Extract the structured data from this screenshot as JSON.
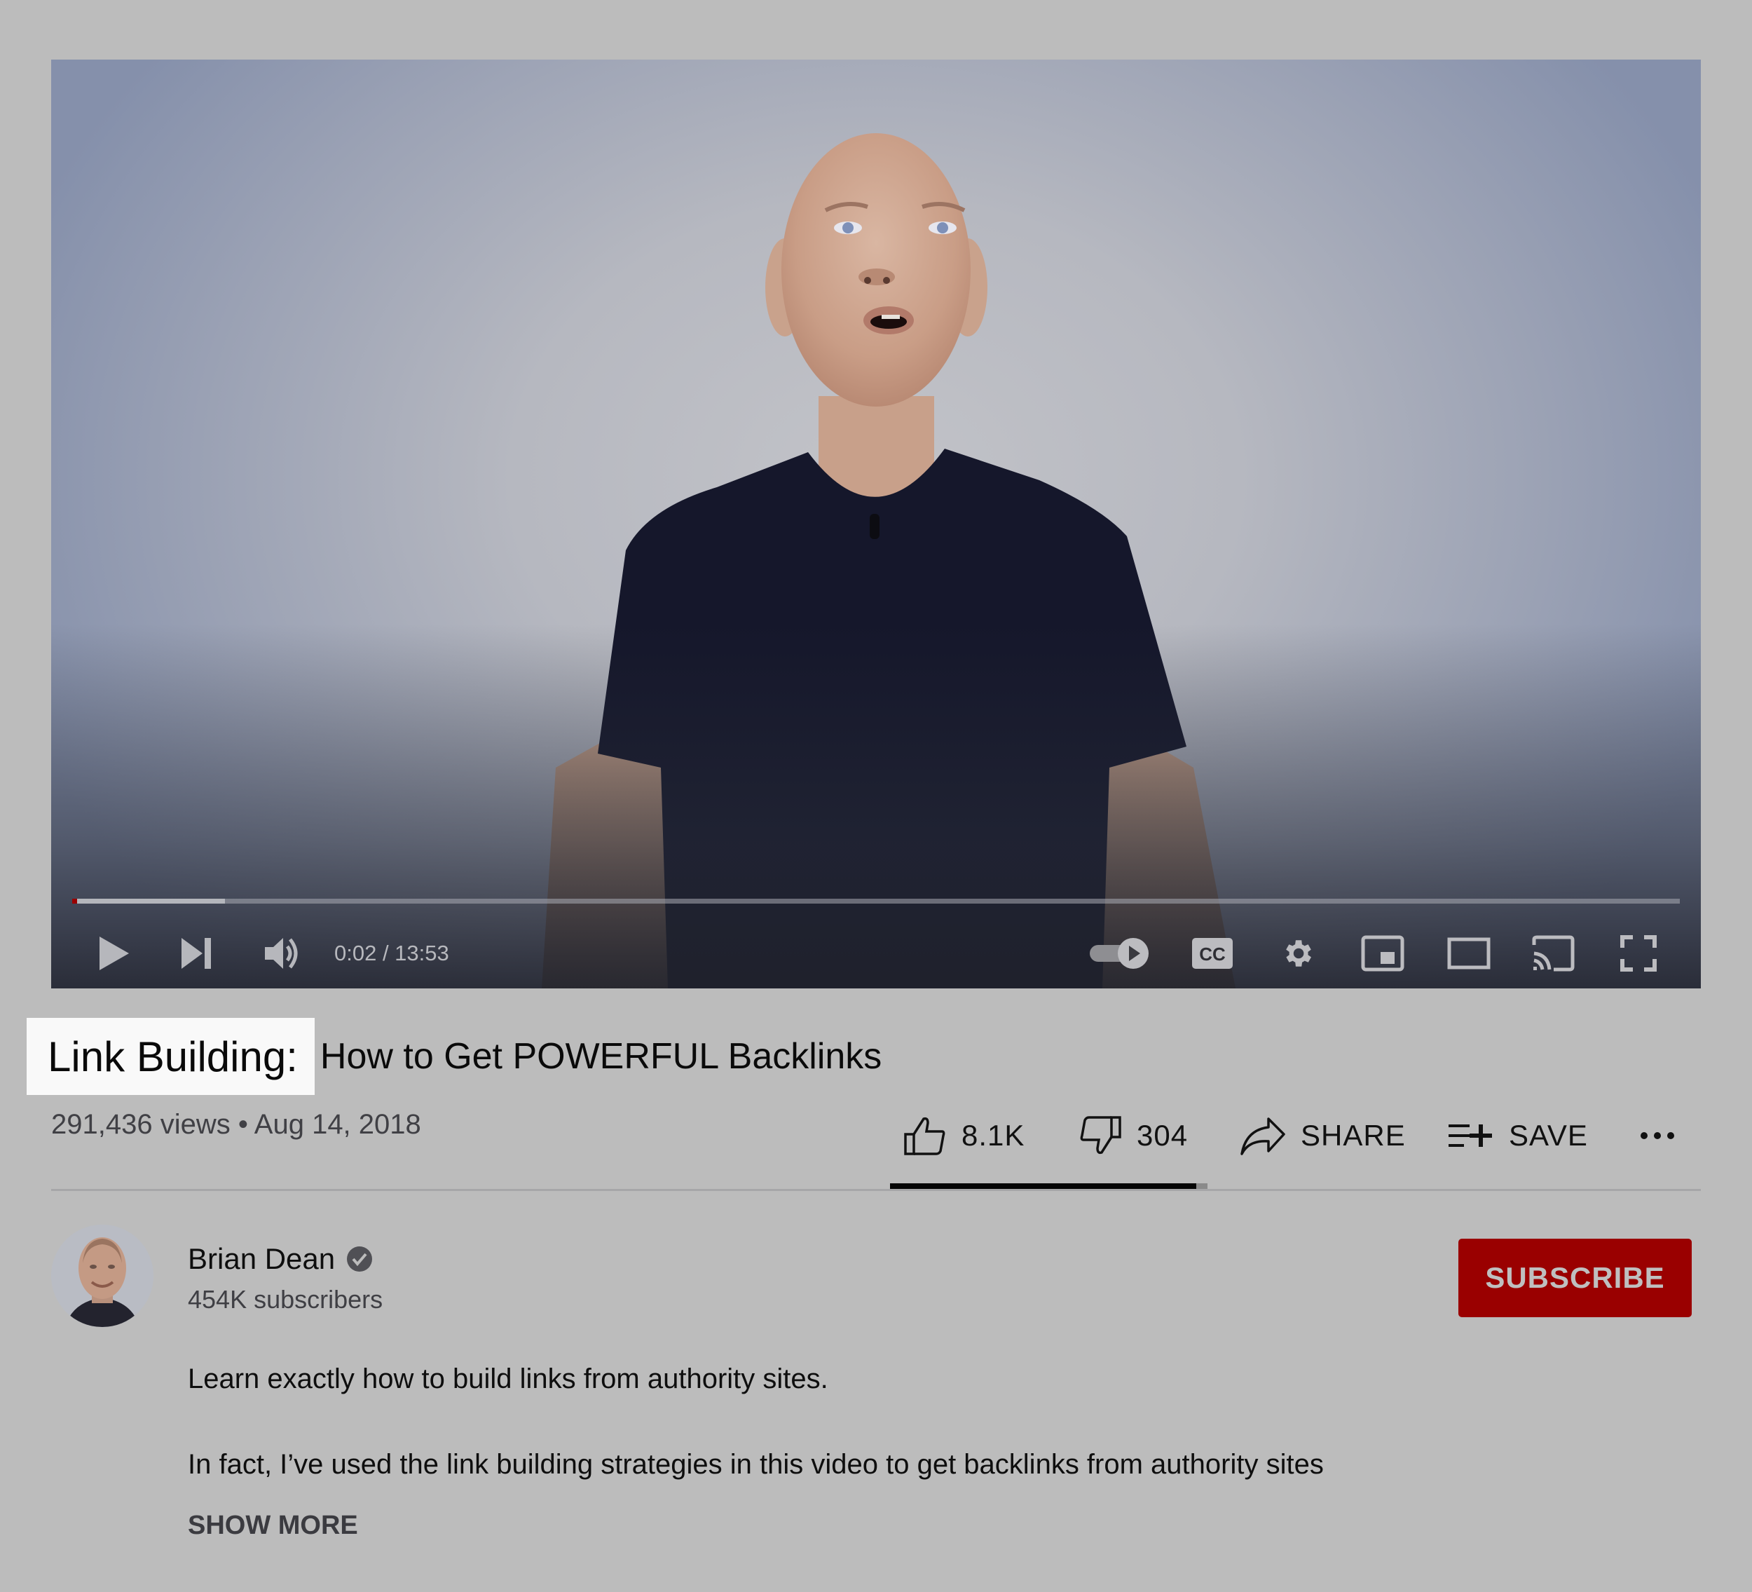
{
  "player": {
    "current_time": "0:02",
    "duration": "13:53",
    "time_display": "0:02 / 13:53",
    "played_fraction": 0.002,
    "buffered_fraction": 0.095,
    "controls": {
      "play": "play-icon",
      "next": "next-icon",
      "volume": "volume-icon",
      "autoplay": "autoplay-toggle-icon",
      "captions": "CC",
      "settings": "gear-icon",
      "miniplayer": "miniplayer-icon",
      "theater": "theater-mode-icon",
      "cast": "cast-icon",
      "fullscreen": "fullscreen-icon"
    }
  },
  "video": {
    "title_highlight": "Link Building:",
    "title_rest": "How to Get POWERFUL Backlinks",
    "views": "291,436 views",
    "separator": "•",
    "date": "Aug 14, 2018",
    "meta_line": "291,436 views • Aug 14, 2018"
  },
  "actions": {
    "likes": "8.1K",
    "dislikes": "304",
    "share": "SHARE",
    "save": "SAVE",
    "more": "...",
    "like_ratio": 0.964
  },
  "channel": {
    "name": "Brian Dean",
    "verified": true,
    "subscribers": "454K subscribers",
    "subscribe_label": "SUBSCRIBE"
  },
  "description": {
    "line1": "Learn exactly how to build links from authority sites.",
    "line2": "In fact, I’ve used the link building strategies in this video to get backlinks from authority sites",
    "show_more": "SHOW MORE"
  },
  "colors": {
    "page_bg": "#bcbcbc",
    "subscribe_bg": "#9a0000",
    "progress_played": "#9a0000",
    "highlight_bg": "#f9f9f9"
  }
}
